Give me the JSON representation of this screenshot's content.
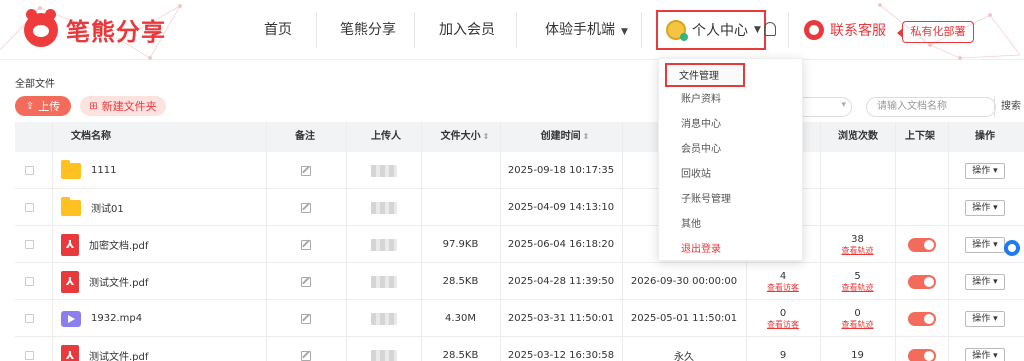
{
  "logo": {
    "text": "笔熊分享"
  },
  "nav": {
    "home": "首页",
    "share": "笔熊分享",
    "join": "加入会员",
    "mobile": "体验手机端",
    "user_center": "个人中心"
  },
  "service": {
    "label": "联系客服"
  },
  "private_deploy": {
    "label": "私有化部署"
  },
  "breadcrumb": "全部文件",
  "toolbar": {
    "upload": "上传",
    "new_folder": "新建文件夹"
  },
  "search": {
    "placeholder": "请输入文档名称",
    "button": "搜索"
  },
  "columns": {
    "name": "文档名称",
    "note": "备注",
    "uploader": "上传人",
    "size": "文件大小",
    "created": "创建时间",
    "views": "浏览次数",
    "shelf": "上下架",
    "ops": "操作"
  },
  "rows": [
    {
      "type": "folder",
      "name": "1111",
      "size": "",
      "created": "2025-09-18 10:17:35",
      "expire": "",
      "visits": "",
      "visits_link": "",
      "views": "",
      "views_link": "",
      "toggle": false,
      "op": "操作"
    },
    {
      "type": "folder",
      "name": "测试01",
      "size": "",
      "created": "2025-04-09 14:13:10",
      "expire": "",
      "visits": "",
      "visits_link": "",
      "views": "",
      "views_link": "",
      "toggle": false,
      "op": "操作"
    },
    {
      "type": "pdf",
      "name": "加密文档.pdf",
      "size": "97.9KB",
      "created": "2025-06-04 16:18:20",
      "expire": "",
      "visits": "",
      "visits_link": "",
      "views": "38",
      "views_link": "查看轨迹",
      "toggle": true,
      "op": "操作"
    },
    {
      "type": "pdf",
      "name": "测试文件.pdf",
      "size": "28.5KB",
      "created": "2025-04-28 11:39:50",
      "expire": "2026-09-30 00:00:00",
      "visits": "4",
      "visits_link": "查看访客",
      "views": "5",
      "views_link": "查看轨迹",
      "toggle": true,
      "op": "操作"
    },
    {
      "type": "video",
      "name": "1932.mp4",
      "size": "4.30M",
      "created": "2025-03-31 11:50:01",
      "expire": "2025-05-01 11:50:01",
      "visits": "0",
      "visits_link": "查看访客",
      "views": "0",
      "views_link": "查看轨迹",
      "toggle": true,
      "op": "操作"
    },
    {
      "type": "pdf",
      "name": "测试文件.pdf",
      "size": "28.5KB",
      "created": "2025-03-12 16:30:58",
      "expire": "永久",
      "visits": "9",
      "visits_link": "",
      "views": "19",
      "views_link": "",
      "toggle": true,
      "op": "操作"
    }
  ],
  "dropdown": {
    "items": [
      "文件管理",
      "账户资料",
      "消息中心",
      "会员中心",
      "回收站",
      "子账号管理",
      "其他"
    ],
    "logout": "退出登录"
  },
  "colors": {
    "brand": "#e8393c",
    "accent": "#f26b5b"
  },
  "icons": [
    "bear-logo-icon",
    "avatar-icon",
    "bell-icon",
    "headset-icon",
    "folder-icon",
    "pdf-icon",
    "video-icon",
    "edit-icon",
    "upload-icon",
    "new-folder-icon",
    "chat-float-icon"
  ]
}
